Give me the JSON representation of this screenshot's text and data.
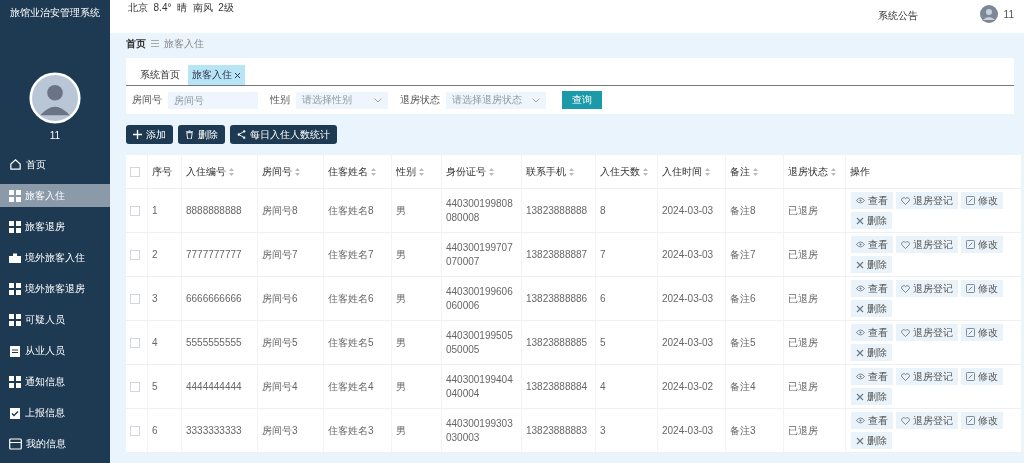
{
  "sidebar": {
    "title": "旅馆业治安管理系统",
    "user": "11",
    "items": [
      {
        "label": "首页",
        "kind": "home",
        "selected": false
      },
      {
        "label": "旅客入住",
        "kind": "grid",
        "selected": true
      },
      {
        "label": "旅客退房",
        "kind": "grid",
        "selected": false
      },
      {
        "label": "境外旅客入住",
        "kind": "briefcase",
        "selected": false
      },
      {
        "label": "境外旅客退房",
        "kind": "grid",
        "selected": false
      },
      {
        "label": "可疑人员",
        "kind": "grid",
        "selected": false
      },
      {
        "label": "从业人员",
        "kind": "clipboard",
        "selected": false
      },
      {
        "label": "通知信息",
        "kind": "grid",
        "selected": false
      },
      {
        "label": "上报信息",
        "kind": "check",
        "selected": false
      },
      {
        "label": "我的信息",
        "kind": "card",
        "selected": false
      }
    ]
  },
  "header": {
    "weather": "北京  8.4°  晴  南风  2级",
    "notice": "系统公告",
    "user": "11"
  },
  "breadcrumb": [
    "首页",
    "旅客入住"
  ],
  "tabs": [
    {
      "label": "系统首页",
      "selected": false,
      "closable": false
    },
    {
      "label": "旅客入住",
      "selected": true,
      "closable": true
    }
  ],
  "filters": [
    {
      "label": "房间号",
      "kind": "input",
      "placeholder": "房间号"
    },
    {
      "label": "性别",
      "kind": "select",
      "placeholder": "请选择性别"
    },
    {
      "label": "退房状态",
      "kind": "select",
      "placeholder": "请选择退房状态"
    }
  ],
  "query_button": "查询",
  "toolbar": [
    {
      "label": "添加",
      "kind": "add"
    },
    {
      "label": "删除",
      "kind": "delete"
    },
    {
      "label": "每日入住人数统计",
      "kind": "share"
    }
  ],
  "table": {
    "all_checked": false,
    "columns": [
      {
        "label": "序号",
        "sortable": false
      },
      {
        "label": "入住编号",
        "sortable": true
      },
      {
        "label": "房间号",
        "sortable": true
      },
      {
        "label": "住客姓名",
        "sortable": true
      },
      {
        "label": "性别",
        "sortable": true
      },
      {
        "label": "身份证号",
        "sortable": true
      },
      {
        "label": "联系手机",
        "sortable": true
      },
      {
        "label": "入住天数",
        "sortable": true
      },
      {
        "label": "入住时间",
        "sortable": true
      },
      {
        "label": "备注",
        "sortable": true
      },
      {
        "label": "退房状态",
        "sortable": true
      },
      {
        "label": "操作",
        "sortable": false
      }
    ],
    "rows": [
      {
        "checked": false,
        "cells": [
          "1",
          "8888888888",
          "房间号8",
          "住客姓名8",
          "男",
          "440300199808080008",
          "13823888888",
          "8",
          "2024-03-03",
          "备注8",
          "已退房"
        ],
        "actions": [
          {
            "label": "查看",
            "kind": "view"
          },
          {
            "label": "退房登记",
            "kind": "checkout"
          },
          {
            "label": "修改",
            "kind": "edit"
          },
          {
            "label": "删除",
            "kind": "delete"
          }
        ]
      },
      {
        "checked": false,
        "cells": [
          "2",
          "7777777777",
          "房间号7",
          "住客姓名7",
          "男",
          "440300199707070007",
          "13823888887",
          "7",
          "2024-03-03",
          "备注7",
          "已退房"
        ],
        "actions": [
          {
            "label": "查看",
            "kind": "view"
          },
          {
            "label": "退房登记",
            "kind": "checkout"
          },
          {
            "label": "修改",
            "kind": "edit"
          },
          {
            "label": "删除",
            "kind": "delete"
          }
        ]
      },
      {
        "checked": false,
        "cells": [
          "3",
          "6666666666",
          "房间号6",
          "住客姓名6",
          "男",
          "440300199606060006",
          "13823888886",
          "6",
          "2024-03-03",
          "备注6",
          "已退房"
        ],
        "actions": [
          {
            "label": "查看",
            "kind": "view"
          },
          {
            "label": "退房登记",
            "kind": "checkout"
          },
          {
            "label": "修改",
            "kind": "edit"
          },
          {
            "label": "删除",
            "kind": "delete"
          }
        ]
      },
      {
        "checked": false,
        "cells": [
          "4",
          "5555555555",
          "房间号5",
          "住客姓名5",
          "男",
          "440300199505050005",
          "13823888885",
          "5",
          "2024-03-03",
          "备注5",
          "已退房"
        ],
        "actions": [
          {
            "label": "查看",
            "kind": "view"
          },
          {
            "label": "退房登记",
            "kind": "checkout"
          },
          {
            "label": "修改",
            "kind": "edit"
          },
          {
            "label": "删除",
            "kind": "delete"
          }
        ]
      },
      {
        "checked": false,
        "cells": [
          "5",
          "4444444444",
          "房间号4",
          "住客姓名4",
          "男",
          "440300199404040004",
          "13823888884",
          "4",
          "2024-03-02",
          "备注4",
          "已退房"
        ],
        "actions": [
          {
            "label": "查看",
            "kind": "view"
          },
          {
            "label": "退房登记",
            "kind": "checkout"
          },
          {
            "label": "修改",
            "kind": "edit"
          },
          {
            "label": "删除",
            "kind": "delete"
          }
        ]
      },
      {
        "checked": false,
        "cells": [
          "6",
          "3333333333",
          "房间号3",
          "住客姓名3",
          "男",
          "440300199303030003",
          "13823888883",
          "3",
          "2024-03-03",
          "备注3",
          "已退房"
        ],
        "actions": [
          {
            "label": "查看",
            "kind": "view"
          },
          {
            "label": "退房登记",
            "kind": "checkout"
          },
          {
            "label": "修改",
            "kind": "edit"
          },
          {
            "label": "删除",
            "kind": "delete"
          }
        ]
      }
    ]
  }
}
